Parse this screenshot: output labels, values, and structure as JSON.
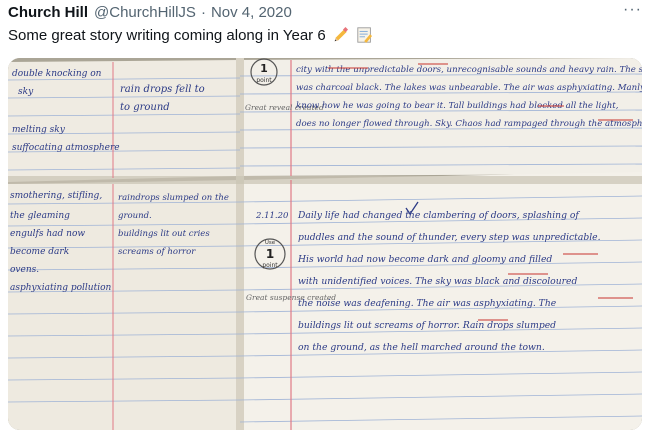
{
  "tweet": {
    "author_name": "Church Hill",
    "handle": "@ChurchHillJS",
    "separator": "·",
    "date": "Nov 4, 2020",
    "more_glyph": "···",
    "text": "Some great story writing coming along in Year 6",
    "emojis": [
      "pencil-icon",
      "memo-icon"
    ]
  },
  "notebook": {
    "top_left_words": [
      "double knocking on",
      "sky",
      "melting sky",
      "suffocating atmosphere"
    ],
    "top_middle_words": [
      "rain drops fell to",
      "to ground"
    ],
    "top_right_lines": [
      "city with the unpredictable doors, unrecognisable sounds and heavy rain. The sky",
      "was charcoal black. The lakes was unbearable. The air was asphyxiating. Manly didn't",
      "know how he was going to bear it. Tall buildings had blocked all the light,",
      "does no longer flowed through. Sky. Chaos had rampaged through the atmosphere"
    ],
    "top_margin_note": "Great reveal created",
    "bottom_left_words": [
      "smothering, stifling,",
      "the gleaming",
      "engulfs had now",
      "become dark",
      "ovens.",
      "asphyxiating pollution"
    ],
    "bottom_middle_words": [
      "raindrops slumped on the",
      "ground.",
      "buildings lit out cries",
      "screams of horror"
    ],
    "date_line": "2.11.20",
    "bottom_right_lines": [
      "Daily life had changed the clambering of doors, splashing of",
      "puddles and the sound of thunder, every step was unpredictable.",
      "His world had now become dark and gloomy and filled",
      "with unidentified voices. The sky was black and discoloured",
      "the noise was deafening. The air was asphyxiating. The",
      "buildings lit out screams of horror. Rain drops slumped",
      "on the ground, as the hell marched around the town."
    ],
    "bottom_margin_note": "Great suspense created",
    "stamp_number": "1",
    "stamp_word": "point",
    "stamp_top": "Use"
  },
  "colors": {
    "paper": "#f4f0e7",
    "ink": "#2b3a86",
    "red_ink": "#c8342e",
    "text": "#0f1419",
    "muted": "#536471"
  }
}
